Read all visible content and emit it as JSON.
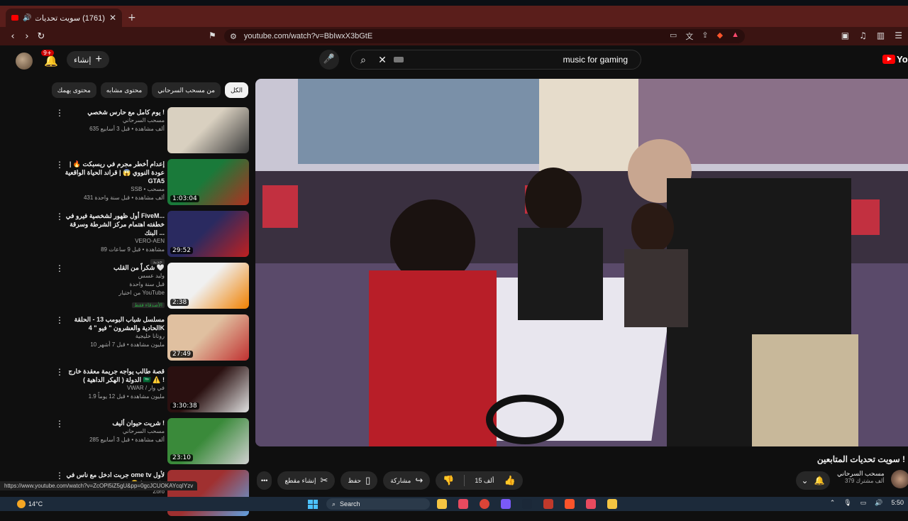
{
  "browser": {
    "tab_title": "(1761) سويت تحديات المتابعين",
    "url": "youtube.com/watch?v=BbIwxX3bGtE",
    "status_url": "https://www.youtube.com/watch?v=ZcOPl5iZ5gU&pp=0gcJCUOKAYcqIYzv"
  },
  "header": {
    "notif_badge": "9+",
    "create_label": "إنشاء",
    "search_query": "music for gaming",
    "logo_text": "You"
  },
  "chips": [
    "الكل",
    "من مسحب السرحاني",
    "محتوى مشابه",
    "محتوى يهمك"
  ],
  "recommendations": [
    {
      "title": "يوم كامل مع حارس شخصي !",
      "channel": "مسحب السرحاني",
      "views": "635 ألف مشاهدة • قبل 3 أسابيع",
      "duration": "",
      "thumb": [
        "#d9d0c0",
        "#3a3a3a"
      ]
    },
    {
      "title": "إعدام أخطر مجرم في ريسبكت 🔥 | عودة النووي 😱 | قراند الحياة الواقعية GTA5",
      "channel": "SSB • مسحب",
      "views": "431 ألف مشاهدة • قبل سنة واحدة",
      "duration": "1:03:04",
      "thumb": [
        "#1a7a3a",
        "#b03020"
      ]
    },
    {
      "title": "أول ظهور لشخصية فيرو في FiveM... خطفته اهتمام مركز الشرطة وسرقة البنك ...",
      "channel": "VERO-AEN",
      "views": "89 مشاهدة • قبل 9 ساعات",
      "tag": "جديد",
      "duration": "29:52",
      "thumb": [
        "#2a2a60",
        "#c02020"
      ]
    },
    {
      "title": "شكراً من القلب 🤍",
      "channel": "وليد عسس",
      "views": "قبل سنة واحدة",
      "extra": "من اختيار YouTube",
      "tag": "الأصدقاء فقط",
      "duration": "2:38",
      "thumb": [
        "#f0f0f0",
        "#f08000"
      ]
    },
    {
      "title": "مسلسل شباب البومب 13 - الحلقة الحادية والعشرون \" فيو \" 4K",
      "channel": "روتانا خليجية",
      "views": "10 مليون مشاهدة • قبل 7 أشهر",
      "duration": "27:49",
      "thumb": [
        "#e0c0a0",
        "#c03030"
      ]
    },
    {
      "title": "قصة طالب يواجه جريمة معقدة خارج الدولة ( الهكر الداهية ) 🇸🇦 ⚠️ !",
      "channel": "VWAR / في وار",
      "views": "1.9 مليون مشاهدة • قبل 12 يوماً",
      "duration": "3:30:38",
      "thumb": [
        "#2a1010",
        "#e0e0e0"
      ]
    },
    {
      "title": "شريت حيوان أليف !",
      "channel": "مسحب السرحاني",
      "views": "285 ألف مشاهدة • قبل 3 أسابيع",
      "duration": "23:10",
      "thumb": [
        "#3a8a3a",
        "#d0d0d0"
      ]
    },
    {
      "title": "جربت ادخل مع ناس في ome tv لأول مره 😂 | ome tv",
      "channel": "Zoro",
      "views": "",
      "duration": "",
      "thumb": [
        "#a03030",
        "#60a0e0"
      ]
    }
  ],
  "video": {
    "title": "سويت تحديات المتابعين !",
    "channel": "مسحب السرحاني",
    "subs": "379 ألف مشترك",
    "likes": "15 ألف",
    "share_label": "مشاركة",
    "save_label": "حفظ",
    "clip_label": "إنشاء مقطع"
  },
  "taskbar": {
    "temp": "14°C",
    "search_label": "Search",
    "time": "5:50"
  }
}
